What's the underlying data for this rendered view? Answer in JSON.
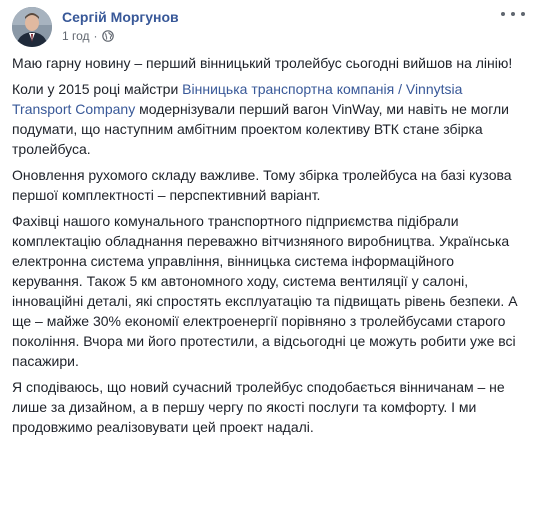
{
  "post": {
    "author": "Сергій Моргунов",
    "time": "1 год",
    "privacy_icon": "globe-icon",
    "more_icon": "more-options-icon",
    "colors": {
      "author": "#385898",
      "link": "#385898",
      "text": "#1d2129",
      "meta": "#616770"
    },
    "paragraphs": {
      "p1": "Маю гарну новину – перший вінницький тролейбус сьогодні вийшов на лінію!",
      "p2_before": "Коли у 2015 році майстри ",
      "p2_link": "Вінницька транспортна компанія / Vinnytsia Transport Company",
      "p2_after": " модернізували перший вагон VinWay, ми навіть не могли подумати, що наступним амбітним проектом колективу ВТК стане збірка тролейбуса.",
      "p3": "Оновлення рухомого складу важливе. Тому збірка тролейбуса на базі кузова першої комплектності – перспективний варіант.",
      "p4": "Фахівці нашого комунального транспортного підприємства підібрали комплектацію обладнання переважно вітчизняного виробництва. Українська електронна система управління, вінницька система інформаційного керування. Також 5 км автономного ходу, система вентиляції у салоні, інноваційні деталі, які спростять експлуатацію та підвищать рівень безпеки. А ще – майже 30% економії електроенергії порівняно з тролейбусами старого покоління. Вчора ми його протестили, а відсьогодні це можуть робити уже всі пасажири.",
      "p5": "Я сподіваюсь, що новий сучасний тролейбус сподобається вінничанам – не лише за дизайном, а в першу чергу по якості послуги та комфорту. І ми продовжимо реалізовувати цей проект надалі."
    }
  }
}
